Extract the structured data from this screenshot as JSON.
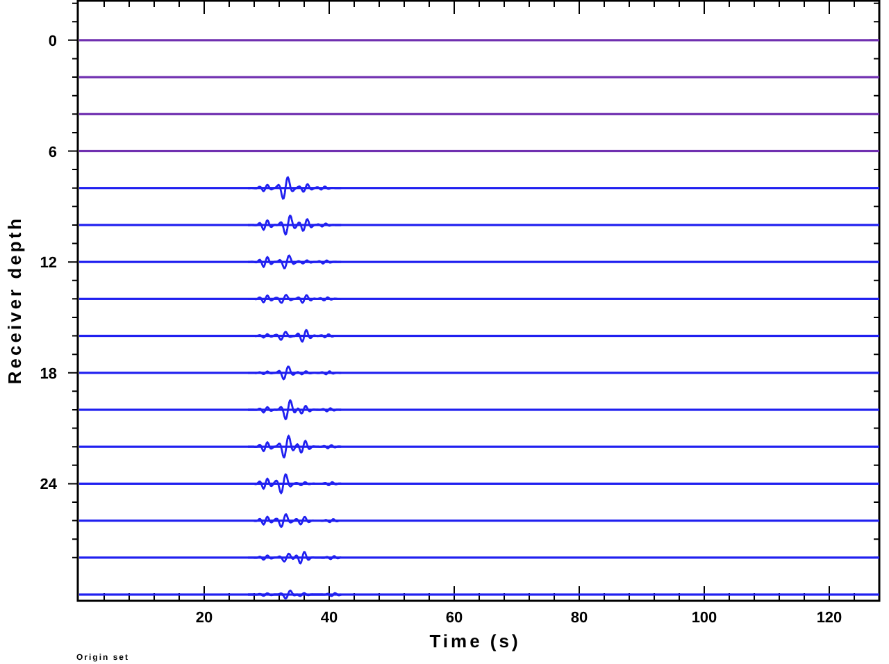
{
  "chart_data": {
    "type": "line",
    "xlabel": "Time (s)",
    "ylabel": "Receiver depth",
    "xlim": [
      0,
      128
    ],
    "ylim": [
      30.3,
      -2.1
    ],
    "xticks": [
      20,
      40,
      60,
      80,
      100,
      120
    ],
    "yticks": [
      0,
      6,
      12,
      18,
      24
    ],
    "ref_lines": [
      {
        "axis": "y",
        "value": 0,
        "color": "#7030b0"
      },
      {
        "axis": "y",
        "value": 2,
        "color": "#7030b0"
      },
      {
        "axis": "y",
        "value": 4,
        "color": "#7030b0"
      },
      {
        "axis": "y",
        "value": 6,
        "color": "#7030b0"
      },
      {
        "axis": "y",
        "value": 8,
        "color": "#2020f0"
      },
      {
        "axis": "y",
        "value": 10,
        "color": "#2020f0"
      },
      {
        "axis": "y",
        "value": 12,
        "color": "#2020f0"
      },
      {
        "axis": "y",
        "value": 14,
        "color": "#2020f0"
      },
      {
        "axis": "y",
        "value": 16,
        "color": "#2020f0"
      },
      {
        "axis": "y",
        "value": 18,
        "color": "#2020f0"
      },
      {
        "axis": "y",
        "value": 20,
        "color": "#2020f0"
      },
      {
        "axis": "y",
        "value": 22,
        "color": "#2020f0"
      },
      {
        "axis": "y",
        "value": 24,
        "color": "#2020f0"
      },
      {
        "axis": "y",
        "value": 26,
        "color": "#2020f0"
      },
      {
        "axis": "y",
        "value": 28,
        "color": "#2020f0"
      },
      {
        "axis": "y",
        "value": 30,
        "color": "#2020f0"
      }
    ]
  },
  "note": "Origin set"
}
